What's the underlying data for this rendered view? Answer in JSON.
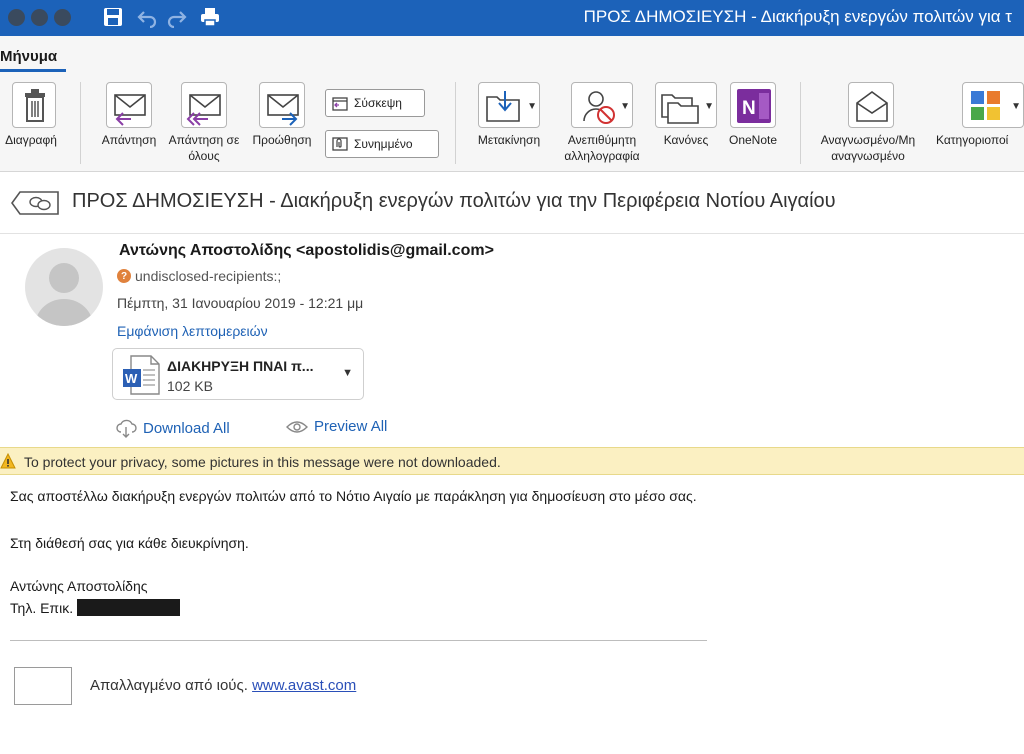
{
  "window": {
    "title": "ΠΡΟΣ ΔΗΜΟΣΙΕΥΣΗ - Διακήρυξη ενεργών πολιτών για τ",
    "titlebar_color": "#1c62b9"
  },
  "ribbon": {
    "tab": "Μήνυμα",
    "buttons": {
      "delete": "Διαγραφή",
      "reply": "Απάντηση",
      "reply_all": "Απάντηση σε όλους",
      "forward": "Προώθηση",
      "meeting": "Σύσκεψη",
      "attachment": "Συνημμένο",
      "move": "Μετακίνηση",
      "junk": "Ανεπιθύμητη αλληλογραφία",
      "rules": "Κανόνες",
      "onenote": "OneNote",
      "read_unread": "Αναγνωσμένο/Μη αναγνωσμένο",
      "categorize": "Κατηγοριοποί"
    }
  },
  "message": {
    "subject": "ΠΡΟΣ ΔΗΜΟΣΙΕΥΣΗ - Διακήρυξη ενεργών πολιτών για την Περιφέρεια Νοτίου Αιγαίου",
    "sender": "Αντώνης Αποστολίδης <apostolidis@gmail.com>",
    "recipients": "undisclosed-recipients:;",
    "date": "Πέμπτη, 31 Ιανουαρίου 2019 - 12:21 μμ",
    "show_details": "Εμφάνιση λεπτομερειών",
    "attachment": {
      "name": "ΔΙΑΚΗΡΥΞΗ ΠΝΑΙ π...",
      "size": "102 KB"
    },
    "download_all": "Download All",
    "preview_all": "Preview All",
    "privacy_notice": "To protect your privacy, some pictures in this message were not downloaded.",
    "body": {
      "line1": "Σας αποστέλλω διακήρυξη ενεργών πολιτών από το Νότιο Αιγαίο με παράκληση για δημοσίευση στο μέσο σας.",
      "line2": "Στη διάθεσή σας για κάθε διευκρίνηση.",
      "signature_name": "Αντώνης Αποστολίδης",
      "signature_phone_label": "Τηλ. Επικ."
    },
    "avast": {
      "text": "Απαλλαγμένο από ιούς.",
      "link": "www.avast.com"
    }
  }
}
